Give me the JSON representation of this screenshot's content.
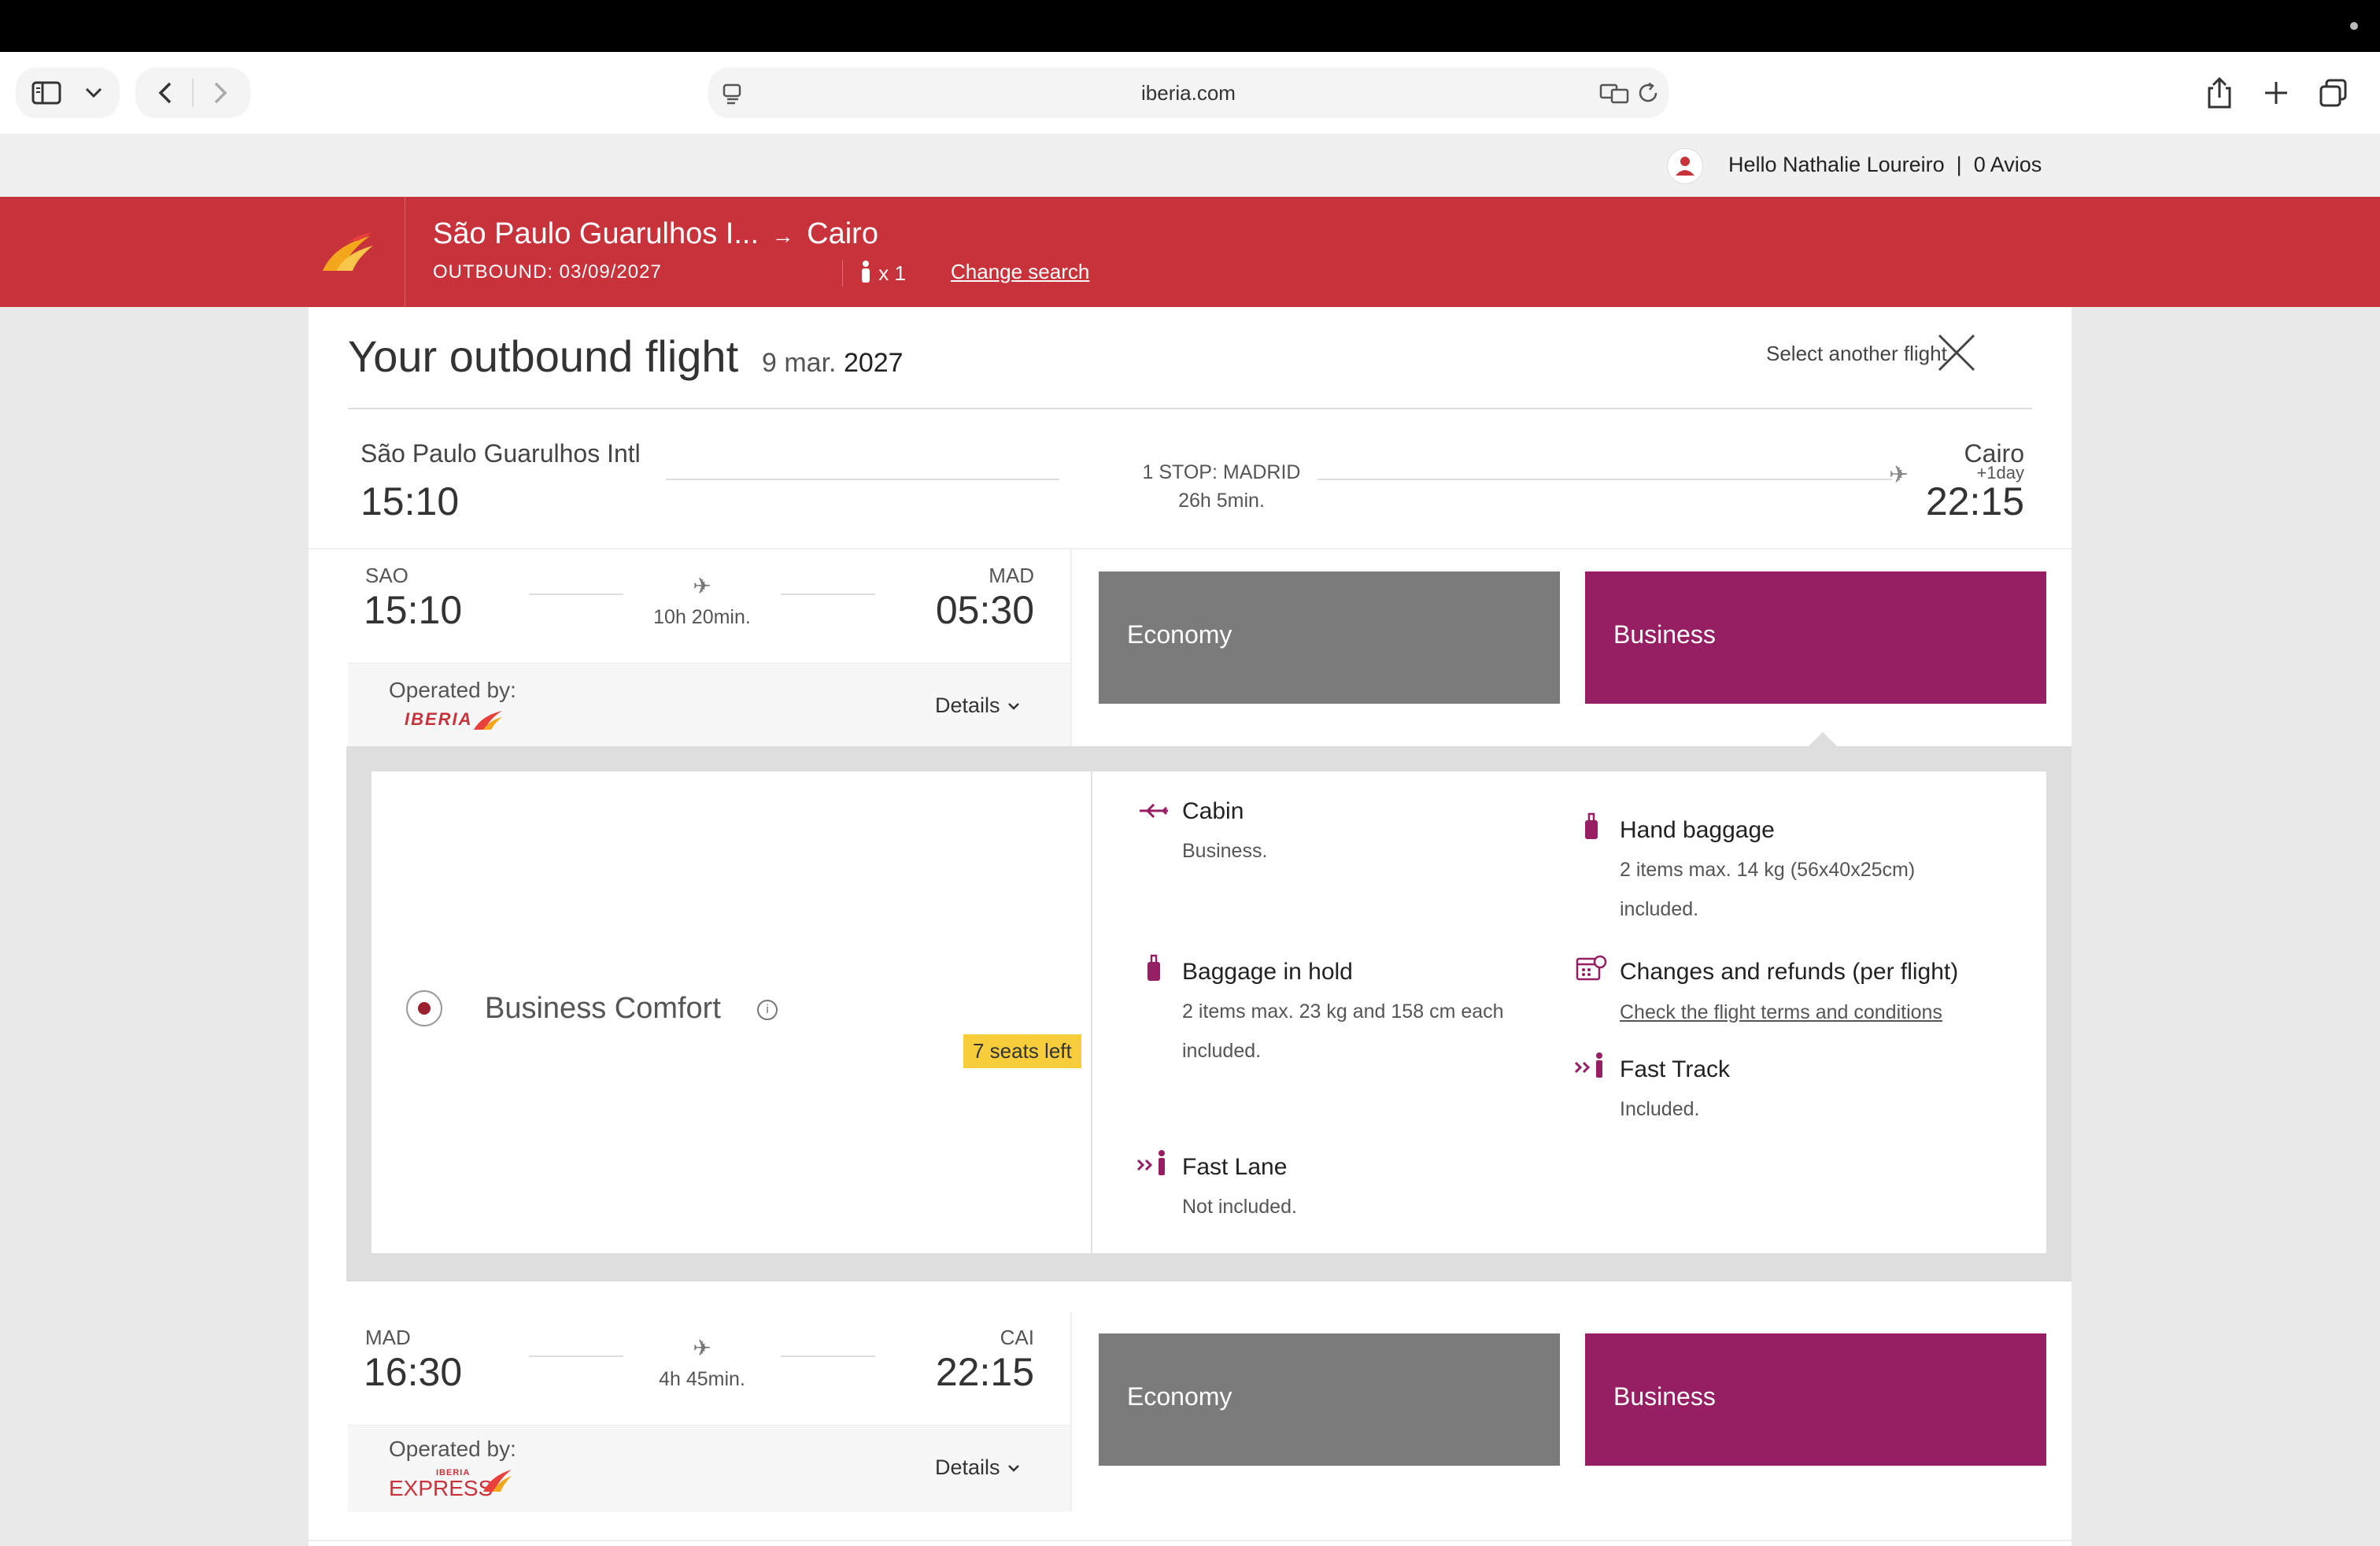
{
  "browser": {
    "url": "iberia.com"
  },
  "greeting": {
    "hello": "Hello Nathalie Loureiro",
    "avios": "0 Avios"
  },
  "header": {
    "origin": "São Paulo Guarulhos I...",
    "arrow": "→",
    "destination": "Cairo",
    "outbound": "OUTBOUND: 03/09/2027",
    "pax": "x 1",
    "change_search": "Change search"
  },
  "title": {
    "text": "Your outbound flight",
    "date": "9 mar.",
    "year": "2027",
    "select_another": "Select another flight"
  },
  "overview": {
    "from_name": "São Paulo Guarulhos Intl",
    "from_time": "15:10",
    "stop": "1 STOP: MADRID",
    "duration": "26h 5min.",
    "to_name": "Cairo",
    "plus_day": "+1day",
    "to_time": "22:15"
  },
  "segments": [
    {
      "from_code": "SAO",
      "from_time": "15:10",
      "duration": "10h 20min.",
      "to_code": "MAD",
      "to_time": "05:30",
      "operated_label": "Operated by:",
      "operator": "IBERIA",
      "details": "Details",
      "fare_economy": "Economy",
      "fare_business": "Business"
    },
    {
      "from_code": "MAD",
      "from_time": "16:30",
      "duration": "4h 45min.",
      "to_code": "CAI",
      "to_time": "22:15",
      "operated_label": "Operated by:",
      "operator_small": "IBERIA",
      "operator": "EXPRESS",
      "details": "Details",
      "fare_economy": "Economy",
      "fare_business": "Business"
    }
  ],
  "fare_panel": {
    "name": "Business Comfort",
    "seats_left": "7 seats left",
    "features": {
      "cabin": {
        "title": "Cabin",
        "text": "Business."
      },
      "hand_baggage": {
        "title": "Hand baggage",
        "line1": "2 items max. 14 kg (56x40x25cm)",
        "line2": "included."
      },
      "baggage_hold": {
        "title": "Baggage in hold",
        "line1": "2 items max. 23 kg and 158 cm each",
        "line2": "included."
      },
      "changes": {
        "title": "Changes and refunds (per flight)",
        "link": "Check the flight terms and conditions"
      },
      "fast_track": {
        "title": "Fast Track",
        "text": "Included."
      },
      "fast_lane": {
        "title": "Fast Lane",
        "text": "Not included."
      }
    }
  },
  "colors": {
    "iberia_red": "#c8323a",
    "business_purple": "#961e62",
    "economy_gray": "#7b7b7b",
    "seats_badge": "#f8cd3c"
  }
}
